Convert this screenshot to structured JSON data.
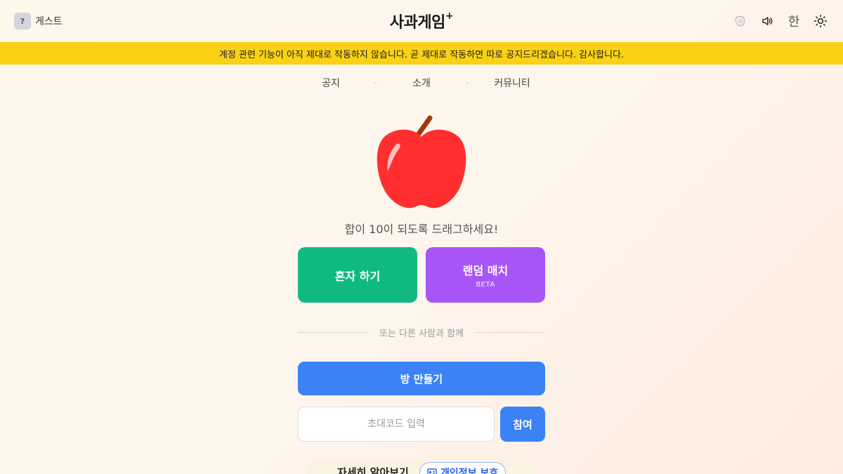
{
  "header": {
    "guest_avatar": "?",
    "guest_label": "게스트",
    "logo": "사과게임",
    "logo_sup": "+",
    "icons": [
      "settings-icon",
      "volume-icon",
      "language-toggle",
      "sun-icon"
    ],
    "language_label": "한"
  },
  "banner": {
    "text": "계정 관련 기능이 아직 제대로 작동하지 않습니다. 곧 제대로 작동하면 따로 공지드리겠습니다. 감사합니다."
  },
  "nav": {
    "items": [
      "공지",
      "소개",
      "커뮤니티"
    ]
  },
  "main": {
    "tagline": "합이 10이 되도록 드래그하세요!",
    "solo_label": "혼자 하기",
    "random_label": "랜덤 매치",
    "random_badge": "BETA",
    "divider_text": "또는 다른 사람과 함께",
    "create_room_label": "방 만들기",
    "invite_placeholder": "초대코드 입력",
    "join_label": "참여"
  },
  "footer": {
    "learn_more": "자세히 알아보기",
    "privacy": "개인정보 보호"
  },
  "colors": {
    "banner": "#fad114",
    "solo": "#10b981",
    "random": "#a855f7",
    "primary": "#3b82f6",
    "apple": "#ff2f2f"
  }
}
